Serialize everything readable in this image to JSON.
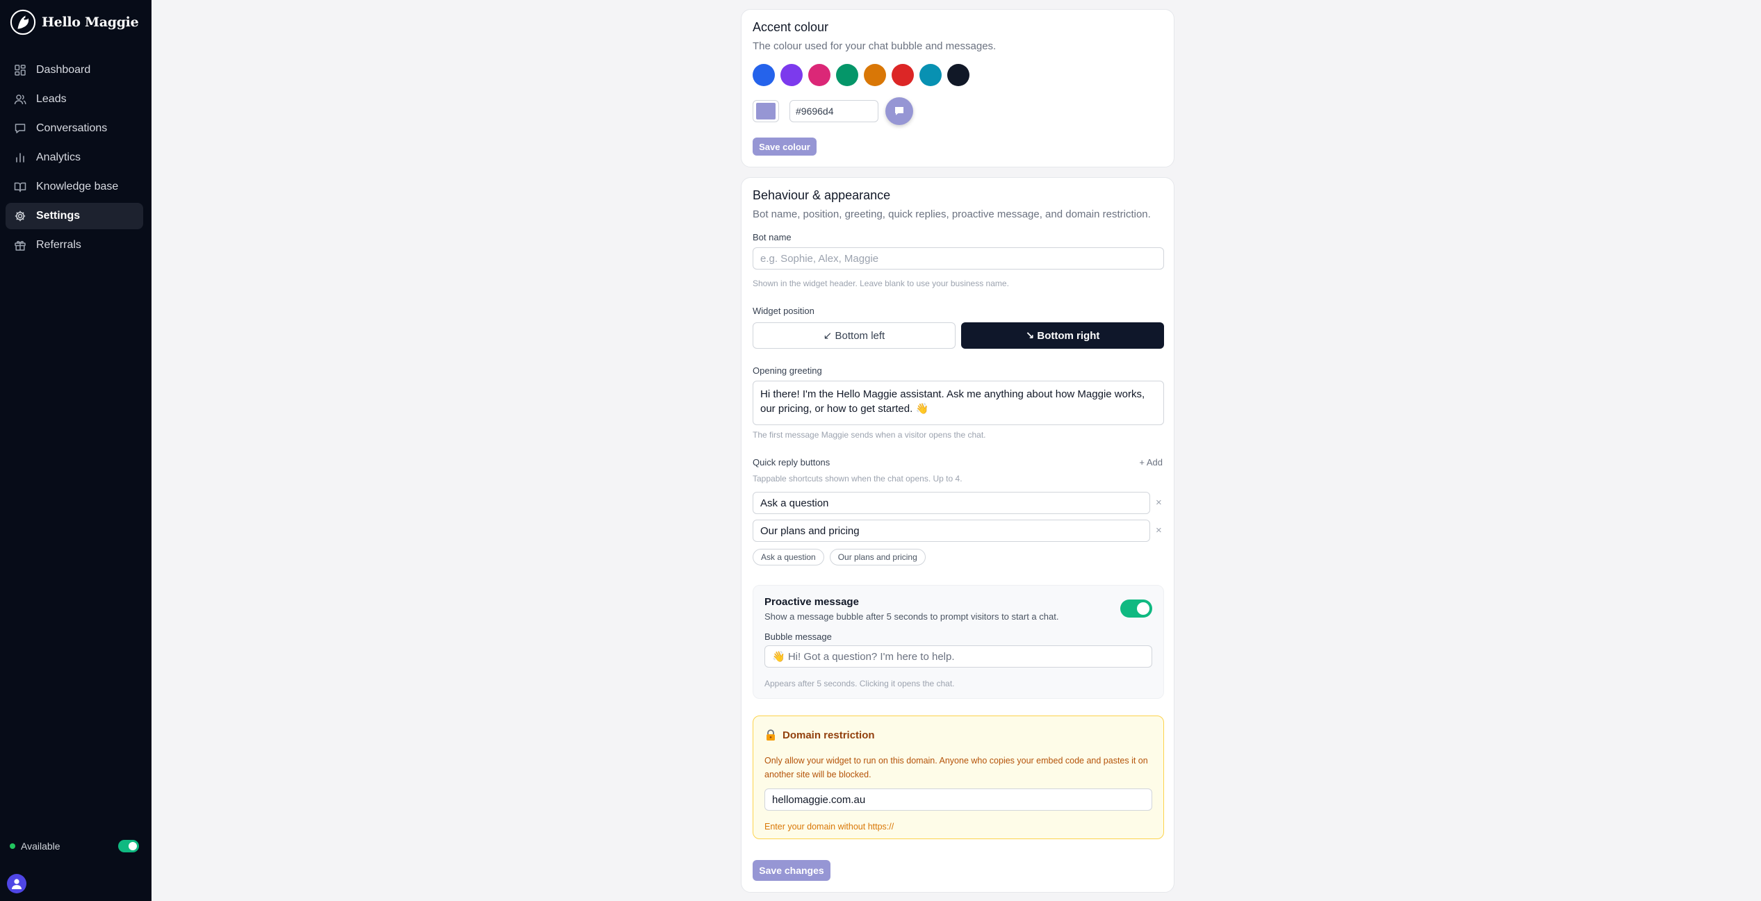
{
  "brand": {
    "name": "Hello Maggie"
  },
  "sidebar": {
    "items": [
      {
        "label": "Dashboard",
        "icon": "dashboard-icon",
        "active": false
      },
      {
        "label": "Leads",
        "icon": "users-icon",
        "active": false
      },
      {
        "label": "Conversations",
        "icon": "chat-icon",
        "active": false
      },
      {
        "label": "Analytics",
        "icon": "bar-chart-icon",
        "active": false
      },
      {
        "label": "Knowledge base",
        "icon": "book-icon",
        "active": false
      },
      {
        "label": "Settings",
        "icon": "gear-icon",
        "active": true
      },
      {
        "label": "Referrals",
        "icon": "gift-icon",
        "active": false
      }
    ],
    "status": {
      "label": "Available",
      "enabled": true
    }
  },
  "accent": {
    "title": "Accent colour",
    "subtitle": "The colour used for your chat bubble and messages.",
    "swatches": [
      "#2563eb",
      "#7c3aed",
      "#db2777",
      "#059669",
      "#d97706",
      "#dc2626",
      "#0891b2",
      "#111827"
    ],
    "current": "#9696d4",
    "hex_value": "#9696d4",
    "save_label": "Save colour"
  },
  "behaviour": {
    "title": "Behaviour & appearance",
    "subtitle": "Bot name, position, greeting, quick replies, proactive message, and domain restriction.",
    "bot_name": {
      "label": "Bot name",
      "placeholder": "e.g. Sophie, Alex, Maggie",
      "value": "",
      "hint": "Shown in the widget header. Leave blank to use your business name."
    },
    "position": {
      "label": "Widget position",
      "left_label": "↙ Bottom left",
      "right_label": "↘ Bottom right",
      "selected": "right"
    },
    "greeting": {
      "label": "Opening greeting",
      "value": "Hi there! I'm the Hello Maggie assistant. Ask me anything about how Maggie works, our pricing, or how to get started. 👋",
      "hint": "The first message Maggie sends when a visitor opens the chat."
    },
    "quick_replies": {
      "label": "Quick reply buttons",
      "add_label": "+ Add",
      "hint": "Tappable shortcuts shown when the chat opens. Up to 4.",
      "items": [
        "Ask a question",
        "Our plans and pricing"
      ],
      "remove_label": "×"
    },
    "proactive": {
      "title": "Proactive message",
      "subtitle": "Show a message bubble after 5 seconds to prompt visitors to start a chat.",
      "enabled": true,
      "bubble_label": "Bubble message",
      "bubble_placeholder": "👋 Hi! Got a question? I'm here to help.",
      "hint": "Appears after 5 seconds. Clicking it opens the chat."
    },
    "domain": {
      "icon": "lock-icon",
      "title": "Domain restriction",
      "description": "Only allow your widget to run on this domain. Anyone who copies your embed code and pastes it on another site will be blocked.",
      "value": "hellomaggie.com.au",
      "hint": "Enter your domain without https://"
    },
    "save_label": "Save changes"
  }
}
